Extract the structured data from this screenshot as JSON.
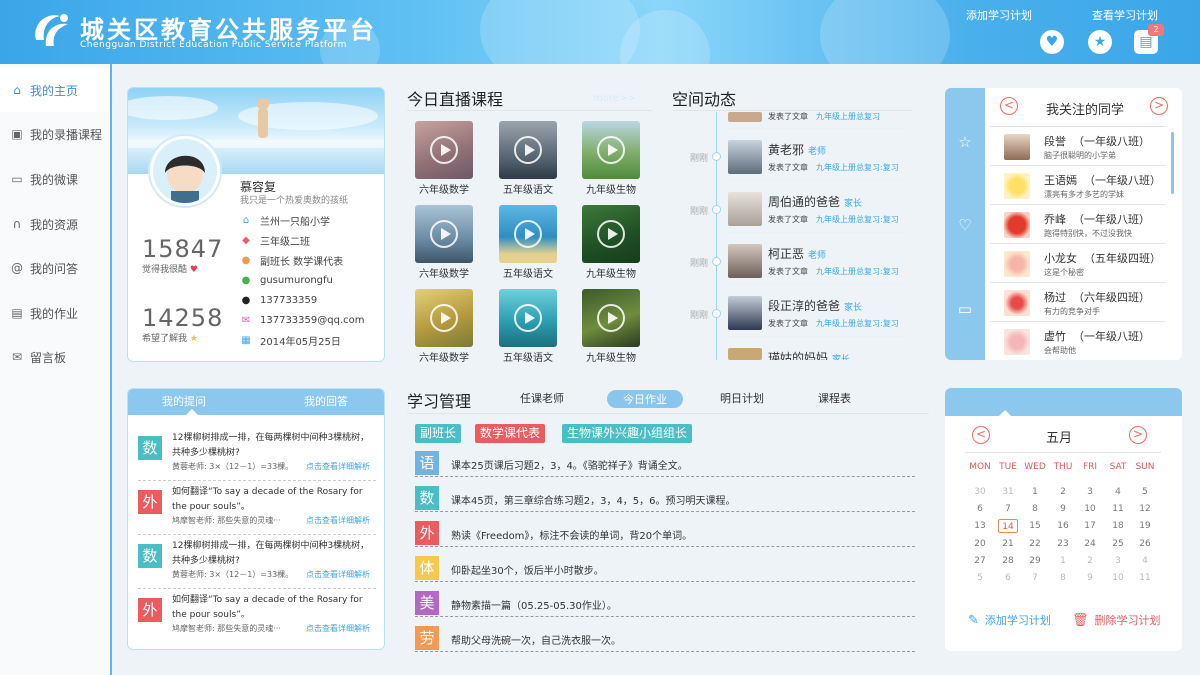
{
  "header": {
    "title": "城关区教育公共服务平台",
    "subtitle": "Chengguan District Education Public Service Platform",
    "notification_count": "2",
    "icons": [
      "heart-icon",
      "star-icon",
      "message-icon"
    ]
  },
  "sidebar": {
    "items": [
      {
        "label": "我的主页",
        "icon": "home-icon"
      },
      {
        "label": "我的录播课程",
        "icon": "video-icon"
      },
      {
        "label": "我的微课",
        "icon": "chat-icon"
      },
      {
        "label": "我的资源",
        "icon": "headphone-icon"
      },
      {
        "label": "我的问答",
        "icon": "at-icon"
      },
      {
        "label": "我的作业",
        "icon": "homework-icon"
      },
      {
        "label": "留言板",
        "icon": "mail-icon"
      }
    ]
  },
  "profile": {
    "name": "慕容复",
    "motto": "我只是一个热爱奥数的孩纸",
    "school": "兰州一只船小学",
    "class": "三年级二班",
    "role": "副班长  数学课代表",
    "wechat": "gusumurongfu",
    "qq": "137733359",
    "email": "137733359@qq.com",
    "date": "2014年05月25日",
    "stat1_value": "15847",
    "stat1_label": "觉得我很酷",
    "stat2_value": "14258",
    "stat2_label": "希望了解我"
  },
  "live": {
    "title": "今日直播课程",
    "more": "more>>",
    "courses": [
      {
        "label": "六年级数学"
      },
      {
        "label": "五年级语文"
      },
      {
        "label": "九年级生物"
      },
      {
        "label": "六年级数学"
      },
      {
        "label": "五年级语文"
      },
      {
        "label": "九年级生物"
      },
      {
        "label": "六年级数学"
      },
      {
        "label": "五年级语文"
      },
      {
        "label": "九年级生物"
      }
    ]
  },
  "feed": {
    "title": "空间动态",
    "time": "刚刚",
    "top_partial": "发表了文章",
    "top_partial_link": "九年级上册总复习",
    "items": [
      {
        "name": "黄老邪",
        "role": "老师",
        "action": "发表了文章",
        "link": "九年级上册总复习:复习"
      },
      {
        "name": "周伯通的爸爸",
        "role": "家长",
        "action": "发表了文章",
        "link": "九年级上册总复习:复习"
      },
      {
        "name": "柯正恶",
        "role": "老师",
        "action": "发表了文章",
        "link": "九年级上册总复习:复习"
      },
      {
        "name": "段正淳的爸爸",
        "role": "家长",
        "action": "发表了文章",
        "link": "九年级上册总复习:复习"
      },
      {
        "name": "瑛姑的妈妈",
        "role": "家长"
      }
    ]
  },
  "following": {
    "title": "我关注的同学",
    "prev": "<",
    "next": ">",
    "side_icons": [
      "star-outline-icon",
      "heart-outline-icon",
      "comment-icon"
    ],
    "students": [
      {
        "name": "段誉  （一年级八班）",
        "desc": "脑子很聪明的小学弟"
      },
      {
        "name": "王语嫣  （一年级八班）",
        "desc": "漂亮有多才多艺的学妹"
      },
      {
        "name": "乔峰  （一年级八班）",
        "desc": "跑得特别快，不过没我快"
      },
      {
        "name": "小龙女  （五年级四班）",
        "desc": "这是个秘密"
      },
      {
        "name": "杨过  （六年级四班）",
        "desc": "有力的竞争对手"
      },
      {
        "name": "虚竹  （一年级八班）",
        "desc": "会帮助他"
      }
    ]
  },
  "qa": {
    "tab_questions": "我的提问",
    "tab_answers": "我的回答",
    "items": [
      {
        "subject": "数",
        "color": "#4bbdc5",
        "text": "12棵柳树排成一排，在每两棵树中间种3棵桃树，共种多少棵桃树?",
        "answer": "黄蓉老师: 3×（12－1）=33棵。",
        "link": "点击查看详细解析"
      },
      {
        "subject": "外",
        "color": "#ea5c5f",
        "text": "如何翻译“To say a decade of the Rosary for the pour souls”。",
        "answer": "鸠摩智老师: 那些失意的灵魂···",
        "link": "点击查看详细解析"
      },
      {
        "subject": "数",
        "color": "#4bbdc5",
        "text": "12棵柳树排成一排，在每两棵树中间种3棵桃树，共种多少棵桃树?",
        "answer": "黄蓉老师: 3×（12－1）=33棵。",
        "link": "点击查看详细解析"
      },
      {
        "subject": "外",
        "color": "#ea5c5f",
        "text": "如何翻译“To say a decade of the Rosary for the pour souls”。",
        "answer": "鸠摩智老师: 那些失意的灵魂···",
        "link": "点击查看详细解析"
      }
    ]
  },
  "study": {
    "title": "学习管理",
    "tabs": [
      "任课老师",
      "今日作业",
      "明日计划",
      "课程表"
    ],
    "tags": [
      {
        "label": "副班长",
        "color": "#4bbdc5"
      },
      {
        "label": "数学课代表",
        "color": "#ea5c5f"
      },
      {
        "label": "生物课外兴趣小组组长",
        "color": "#4bbdc5"
      }
    ],
    "homework": [
      {
        "subject": "语",
        "color": "#6fb4e4",
        "text": "课本25页课后习题2，3，4。《骆驼祥子》背诵全文。"
      },
      {
        "subject": "数",
        "color": "#4bbdc5",
        "text": "课本45页，第三章综合练习题2，3，4，5，6。预习明天课程。"
      },
      {
        "subject": "外",
        "color": "#ea5c5f",
        "text": "熟读《Freedom》，标注不会读的单词，背20个单词。"
      },
      {
        "subject": "体",
        "color": "#f5c94e",
        "text": "仰卧起坐30个，饭后半小时散步。"
      },
      {
        "subject": "美",
        "color": "#b467c3",
        "text": "静物素描一篇（05.25-05.30作业）。"
      },
      {
        "subject": "劳",
        "color": "#f19a57",
        "text": "帮助父母洗碗一次，自己洗衣服一次。"
      }
    ]
  },
  "plan": {
    "tab_add": "添加学习计划",
    "tab_view": "查看学习计划",
    "month": "五月",
    "prev": "<",
    "next": ">",
    "weekdays": [
      "MON",
      "TUE",
      "WED",
      "THU",
      "FRI",
      "SAT",
      "SUN"
    ],
    "weeks": [
      [
        "30",
        "31",
        "1",
        "2",
        "3",
        "4",
        "5"
      ],
      [
        "6",
        "7",
        "8",
        "9",
        "10",
        "11",
        "12"
      ],
      [
        "13",
        "14",
        "15",
        "16",
        "17",
        "18",
        "19"
      ],
      [
        "20",
        "21",
        "22",
        "23",
        "24",
        "25",
        "26"
      ],
      [
        "27",
        "28",
        "29",
        "1",
        "2",
        "3",
        "4"
      ],
      [
        "5",
        "6",
        "7",
        "8",
        "9",
        "10",
        "11"
      ]
    ],
    "today": "14",
    "add_action": "添加学习计划",
    "delete_action": "删除学习计划"
  }
}
